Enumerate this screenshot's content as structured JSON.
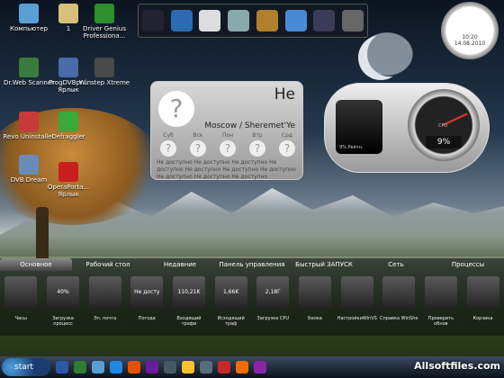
{
  "desktop_icons": [
    {
      "label": "Компьютер",
      "color": "#5a9fd4"
    },
    {
      "label": "1",
      "color": "#d8c07a"
    },
    {
      "label": "Driver Genius Professiona...",
      "color": "#2d8f2d"
    },
    {
      "label": "Dr.Web Scanner",
      "color": "#3a7a3a"
    },
    {
      "label": "ProgDVBpr... Ярлык",
      "color": "#4a6aa8"
    },
    {
      "label": "Winstep Xtreme",
      "color": "#4a4a4a"
    },
    {
      "label": "Revo Uninstaller",
      "color": "#c83a3a"
    },
    {
      "label": "Defraggler",
      "color": "#3aa83a"
    },
    {
      "label": "DVB Dream",
      "color": "#6a8ab8"
    },
    {
      "label": "OperaPorta... Ярлык",
      "color": "#c81e1e"
    }
  ],
  "dock": {
    "items": [
      "NEXUS",
      "windows",
      "clock",
      "trash",
      "radar",
      "pictures",
      "media",
      "misc"
    ]
  },
  "clock_widget": {
    "time": "10:20",
    "date": "14.08.2010"
  },
  "weather": {
    "temp": "He",
    "city": "Moscow / Sheremet'Ye",
    "days": [
      "Суб",
      "Вск",
      "Пон",
      "Втр",
      "Срд"
    ],
    "unavailable": "Не доступно"
  },
  "cpu": {
    "percent": "9%",
    "label": "CPU",
    "scope_text": "9% Рейтн.",
    "needle_percent": 9
  },
  "panel": {
    "tabs": [
      "Основное",
      "Рабочий стол",
      "Недавние",
      "Панель управления",
      "Быстрый ЗАПУСК",
      "Сеть",
      "Процессы"
    ],
    "active_tab": 0,
    "gadgets": [
      {
        "label": "Часы",
        "value": ""
      },
      {
        "label": "Загрузка процесс",
        "value": "40%"
      },
      {
        "label": "Эл. почта",
        "value": ""
      },
      {
        "label": "Погода",
        "value": "Не досту"
      },
      {
        "label": "Входящий трафи",
        "value": "110,21K"
      },
      {
        "label": "Исходящий траф",
        "value": "1,66K"
      },
      {
        "label": "Загрузка CPU",
        "value": "2,18Г"
      },
      {
        "label": "Белка",
        "value": ""
      },
      {
        "label": "НастройкиWinVS",
        "value": ""
      },
      {
        "label": "Справка WinShe",
        "value": ""
      },
      {
        "label": "Проверить обнов",
        "value": ""
      },
      {
        "label": "Корзина",
        "value": ""
      }
    ]
  },
  "taskbar": {
    "start": "start",
    "items": [
      "#2b5aa8",
      "#2e7d32",
      "#5a9fd4",
      "#1e88e5",
      "#e65100",
      "#6a1b9a",
      "#455a64",
      "#fbc02d",
      "#546e7a",
      "#c62828",
      "#ef6c00",
      "#8e24aa"
    ]
  },
  "watermark": "Allsoftfiles.com"
}
